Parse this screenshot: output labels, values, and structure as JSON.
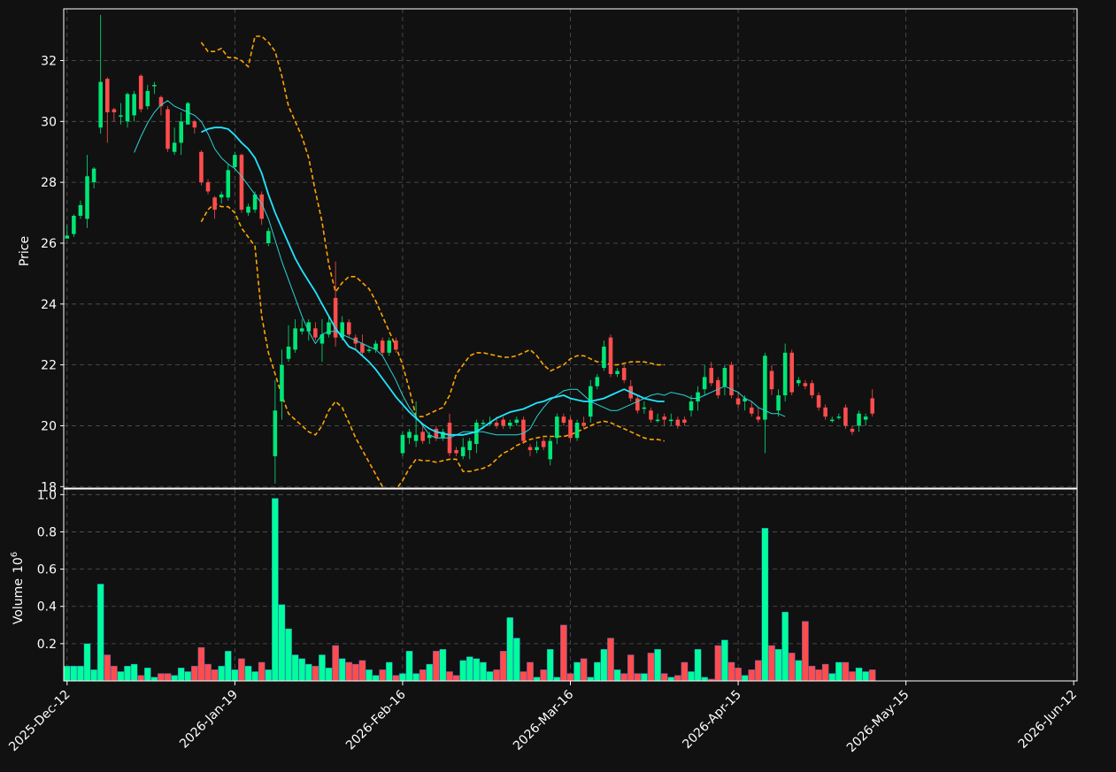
{
  "chart_data": {
    "type": "candlestick",
    "price_panel": {
      "ylabel": "Price",
      "ylim": [
        17.95,
        33.7
      ],
      "yticks": [
        18,
        20,
        22,
        24,
        26,
        28,
        30,
        32
      ],
      "ytick_labels": [
        "18",
        "20",
        "22",
        "24",
        "26",
        "28",
        "30",
        "32"
      ],
      "grid": true
    },
    "volume_panel": {
      "ylabel": "Volume",
      "ylabel_exponent": "10",
      "ylabel_exponent_power": "6",
      "ylim": [
        0,
        1.03
      ],
      "yticks": [
        0.2,
        0.4,
        0.6,
        0.8,
        1.0
      ],
      "ytick_labels": [
        "0.2",
        "0.4",
        "0.6",
        "0.8",
        "1.0"
      ],
      "grid": true
    },
    "x_ticks": [
      {
        "index": 0,
        "label": "2025-Dec-12"
      },
      {
        "index": 25,
        "label": "2026-Jan-19"
      },
      {
        "index": 50,
        "label": "2026-Feb-16"
      },
      {
        "index": 75,
        "label": "2026-Mar-16"
      },
      {
        "index": 100,
        "label": "2026-Apr-15"
      },
      {
        "index": 125,
        "label": "2026-May-15"
      },
      {
        "index": 150,
        "label": "2026-Jun-12"
      }
    ],
    "x_range": [
      -0.5,
      150.5
    ],
    "colors": {
      "up": "#00e676",
      "down": "#ff4d4d",
      "up_volume": "#00ff9c",
      "down_volume": "#ff4d4d",
      "sma_short": "#2ad4d4",
      "sma_long": "#22e5ff",
      "bands": "#ffa500",
      "background": "#111111",
      "grid": "#555555"
    },
    "candles": [
      [
        26.15,
        26.25,
        26.2,
        26.6
      ],
      [
        26.3,
        26.9,
        26.2,
        26.95
      ],
      [
        26.9,
        27.25,
        26.8,
        27.4
      ],
      [
        26.8,
        28.2,
        26.5,
        28.9
      ],
      [
        28.0,
        28.45,
        27.8,
        28.5
      ],
      [
        29.8,
        31.3,
        29.6,
        33.5
      ],
      [
        31.4,
        30.3,
        29.3,
        31.45
      ],
      [
        30.4,
        30.3,
        30.0,
        30.45
      ],
      [
        30.2,
        30.2,
        29.9,
        30.6
      ],
      [
        30.0,
        30.9,
        29.8,
        30.95
      ],
      [
        30.2,
        30.9,
        30.0,
        31.0
      ],
      [
        31.5,
        30.4,
        30.3,
        31.55
      ],
      [
        30.5,
        31.0,
        30.4,
        31.2
      ],
      [
        31.2,
        31.2,
        30.9,
        31.3
      ],
      [
        30.8,
        30.5,
        30.2,
        30.85
      ],
      [
        30.4,
        29.1,
        29.0,
        30.5
      ],
      [
        29.0,
        29.3,
        28.9,
        29.8
      ],
      [
        29.3,
        30.0,
        28.9,
        30.3
      ],
      [
        29.9,
        30.6,
        29.9,
        30.65
      ],
      [
        30.0,
        29.8,
        29.6,
        30.05
      ],
      [
        29.0,
        28.0,
        27.9,
        29.05
      ],
      [
        28.0,
        27.7,
        27.6,
        28.1
      ],
      [
        27.5,
        27.1,
        26.8,
        27.55
      ],
      [
        27.5,
        27.6,
        27.3,
        27.7
      ],
      [
        27.5,
        28.4,
        27.4,
        28.6
      ],
      [
        28.5,
        28.9,
        28.4,
        29.0
      ],
      [
        28.9,
        27.1,
        27.0,
        28.95
      ],
      [
        27.0,
        27.2,
        26.9,
        27.3
      ],
      [
        27.1,
        27.6,
        27.0,
        27.7
      ],
      [
        27.6,
        26.8,
        26.6,
        27.7
      ],
      [
        26.0,
        26.4,
        25.9,
        26.5
      ],
      [
        19.0,
        20.5,
        18.1,
        21.5
      ],
      [
        20.8,
        22.0,
        20.2,
        22.5
      ],
      [
        22.2,
        22.6,
        22.1,
        23.3
      ],
      [
        22.5,
        23.2,
        22.4,
        23.5
      ],
      [
        23.1,
        23.2,
        23.0,
        23.5
      ],
      [
        23.1,
        23.4,
        22.8,
        23.5
      ],
      [
        23.2,
        22.9,
        22.8,
        23.4
      ],
      [
        22.7,
        23.0,
        22.1,
        23.5
      ],
      [
        23.0,
        23.4,
        22.9,
        23.6
      ],
      [
        24.2,
        22.9,
        22.6,
        25.4
      ],
      [
        22.9,
        23.4,
        22.8,
        23.6
      ],
      [
        23.4,
        23.0,
        22.9,
        23.5
      ],
      [
        22.9,
        22.7,
        22.5,
        23.0
      ],
      [
        22.7,
        22.4,
        22.3,
        23.0
      ],
      [
        22.5,
        22.5,
        22.4,
        22.6
      ],
      [
        22.5,
        22.7,
        22.4,
        22.8
      ],
      [
        22.8,
        22.4,
        22.3,
        22.9
      ],
      [
        22.4,
        22.8,
        22.3,
        22.9
      ],
      [
        22.8,
        22.5,
        22.4,
        22.9
      ],
      [
        19.1,
        19.7,
        19.0,
        19.8
      ],
      [
        19.6,
        19.8,
        19.4,
        19.9
      ],
      [
        19.5,
        19.7,
        19.3,
        20.8
      ],
      [
        19.8,
        19.5,
        19.4,
        20.0
      ],
      [
        19.6,
        19.7,
        19.4,
        19.8
      ],
      [
        19.9,
        19.6,
        19.5,
        20.0
      ],
      [
        19.6,
        19.8,
        19.5,
        19.9
      ],
      [
        20.1,
        19.1,
        19.0,
        20.4
      ],
      [
        19.2,
        19.1,
        19.0,
        19.3
      ],
      [
        19.0,
        19.3,
        18.9,
        19.6
      ],
      [
        19.2,
        19.5,
        18.9,
        19.6
      ],
      [
        19.4,
        20.1,
        19.1,
        20.2
      ],
      [
        20.1,
        20.1,
        19.9,
        20.2
      ],
      [
        20.1,
        20.1,
        20.0,
        20.3
      ],
      [
        20.1,
        20.0,
        19.9,
        20.3
      ],
      [
        20.2,
        20.0,
        19.9,
        20.3
      ],
      [
        20.0,
        20.1,
        19.9,
        20.2
      ],
      [
        20.1,
        20.2,
        20.0,
        20.3
      ],
      [
        20.2,
        19.5,
        19.4,
        20.3
      ],
      [
        19.3,
        19.2,
        19.0,
        19.4
      ],
      [
        19.2,
        19.3,
        19.1,
        19.5
      ],
      [
        19.5,
        19.3,
        19.2,
        19.6
      ],
      [
        18.9,
        19.5,
        18.7,
        19.6
      ],
      [
        19.6,
        20.3,
        19.4,
        20.4
      ],
      [
        20.3,
        20.1,
        20.0,
        20.4
      ],
      [
        20.2,
        19.6,
        19.5,
        20.3
      ],
      [
        19.6,
        20.1,
        19.5,
        20.2
      ],
      [
        20.1,
        20.0,
        19.9,
        20.3
      ],
      [
        20.3,
        21.3,
        20.1,
        21.5
      ],
      [
        21.3,
        21.6,
        21.2,
        21.7
      ],
      [
        21.9,
        22.6,
        21.8,
        22.8
      ],
      [
        22.9,
        21.7,
        21.6,
        23.0
      ],
      [
        21.7,
        21.8,
        21.6,
        21.9
      ],
      [
        21.9,
        21.5,
        21.4,
        22.0
      ],
      [
        21.3,
        20.9,
        20.8,
        21.5
      ],
      [
        20.9,
        20.5,
        20.4,
        21.0
      ],
      [
        20.6,
        20.6,
        20.4,
        20.8
      ],
      [
        20.5,
        20.2,
        20.1,
        20.6
      ],
      [
        20.2,
        20.2,
        20.1,
        20.4
      ],
      [
        20.3,
        20.2,
        20.0,
        20.4
      ],
      [
        20.2,
        20.2,
        20.0,
        20.4
      ],
      [
        20.2,
        20.0,
        19.9,
        20.3
      ],
      [
        20.2,
        20.1,
        20.0,
        20.3
      ],
      [
        20.5,
        20.8,
        20.3,
        21.0
      ],
      [
        20.8,
        21.1,
        20.5,
        21.3
      ],
      [
        21.2,
        21.6,
        21.0,
        22.0
      ],
      [
        21.9,
        21.4,
        21.3,
        22.1
      ],
      [
        21.5,
        21.0,
        20.9,
        21.6
      ],
      [
        21.3,
        21.9,
        21.0,
        22.0
      ],
      [
        22.0,
        21.0,
        20.9,
        22.1
      ],
      [
        20.9,
        20.7,
        20.6,
        21.1
      ],
      [
        20.8,
        20.9,
        20.5,
        21.0
      ],
      [
        20.6,
        20.4,
        20.3,
        20.8
      ],
      [
        20.3,
        20.2,
        20.1,
        20.6
      ],
      [
        20.2,
        22.3,
        19.1,
        22.4
      ],
      [
        21.8,
        21.2,
        21.0,
        22.0
      ],
      [
        20.5,
        21.0,
        20.3,
        21.2
      ],
      [
        21.0,
        22.4,
        20.8,
        22.7
      ],
      [
        22.4,
        21.1,
        21.0,
        22.5
      ],
      [
        21.4,
        21.5,
        21.3,
        21.6
      ],
      [
        21.4,
        21.3,
        21.2,
        21.5
      ],
      [
        21.4,
        21.0,
        20.9,
        21.5
      ],
      [
        21.0,
        20.6,
        20.5,
        21.1
      ],
      [
        20.6,
        20.3,
        20.2,
        20.7
      ],
      [
        20.2,
        20.2,
        20.1,
        20.3
      ],
      [
        20.3,
        20.3,
        20.2,
        20.4
      ],
      [
        20.6,
        20.0,
        19.9,
        20.7
      ],
      [
        19.9,
        19.8,
        19.7,
        20.0
      ],
      [
        20.0,
        20.4,
        19.8,
        20.5
      ],
      [
        20.2,
        20.3,
        20.0,
        20.4
      ],
      [
        20.9,
        20.4,
        20.3,
        21.2
      ]
    ],
    "volume": [
      0.08,
      0.08,
      0.08,
      0.2,
      0.06,
      0.52,
      0.14,
      0.08,
      0.05,
      0.08,
      0.09,
      0.03,
      0.07,
      0.02,
      0.04,
      0.04,
      0.03,
      0.07,
      0.05,
      0.08,
      0.18,
      0.09,
      0.06,
      0.08,
      0.16,
      0.06,
      0.12,
      0.08,
      0.05,
      0.1,
      0.06,
      0.98,
      0.41,
      0.28,
      0.14,
      0.12,
      0.09,
      0.08,
      0.14,
      0.07,
      0.19,
      0.12,
      0.1,
      0.09,
      0.11,
      0.06,
      0.03,
      0.06,
      0.1,
      0.03,
      0.04,
      0.16,
      0.04,
      0.06,
      0.09,
      0.16,
      0.17,
      0.05,
      0.03,
      0.11,
      0.13,
      0.12,
      0.1,
      0.05,
      0.06,
      0.16,
      0.34,
      0.23,
      0.05,
      0.1,
      0.02,
      0.06,
      0.17,
      0.02,
      0.3,
      0.04,
      0.1,
      0.12,
      0.02,
      0.1,
      0.17,
      0.23,
      0.06,
      0.04,
      0.14,
      0.04,
      0.04,
      0.15,
      0.17,
      0.04,
      0.02,
      0.03,
      0.1,
      0.05,
      0.17,
      0.02,
      0.01,
      0.19,
      0.22,
      0.1,
      0.07,
      0.03,
      0.06,
      0.11,
      0.82,
      0.19,
      0.17,
      0.37,
      0.15,
      0.11,
      0.32,
      0.08,
      0.06,
      0.09,
      0.04,
      0.1,
      0.1,
      0.05,
      0.07,
      0.05,
      0.06
    ],
    "sma_short": {
      "start": 10,
      "values": [
        28.98,
        29.5,
        29.95,
        30.3,
        30.55,
        30.68,
        30.5,
        30.4,
        30.3,
        30.2,
        30.0,
        29.6,
        29.1,
        28.8,
        28.6,
        28.45,
        28.2,
        27.9,
        27.6,
        27.3,
        26.8,
        26.1,
        25.4,
        24.8,
        24.2,
        23.6,
        23.1,
        22.7,
        23.0,
        23.1,
        23.1,
        23.0,
        22.9,
        22.8,
        22.7,
        22.6,
        22.5,
        22.3,
        21.9,
        21.5,
        21.0,
        20.6,
        20.3,
        20.0,
        19.7,
        19.6,
        19.6,
        19.6,
        19.7,
        19.8,
        19.8,
        19.8,
        19.8,
        19.75,
        19.7,
        19.7,
        19.7,
        19.7,
        19.75,
        19.9,
        20.3,
        20.6,
        20.85,
        21.0,
        21.15,
        21.2,
        21.2,
        21.0,
        20.8,
        20.7,
        20.6,
        20.5,
        20.5,
        20.6,
        20.7,
        20.8,
        20.9,
        21.0,
        21.05,
        21.0,
        21.1,
        21.05,
        21.0,
        20.9,
        20.9,
        21.0,
        21.1,
        21.2,
        21.3,
        21.2,
        21.1,
        20.9,
        20.8,
        20.6,
        20.5,
        20.4,
        20.4,
        20.3
      ]
    },
    "sma_long": {
      "start": 20,
      "values": [
        29.65,
        29.75,
        29.8,
        29.8,
        29.75,
        29.55,
        29.3,
        29.1,
        28.8,
        28.3,
        27.6,
        27.0,
        26.5,
        26.0,
        25.5,
        25.1,
        24.75,
        24.4,
        24.0,
        23.6,
        23.2,
        22.9,
        22.6,
        22.5,
        22.3,
        22.1,
        21.85,
        21.55,
        21.25,
        20.95,
        20.7,
        20.45,
        20.25,
        20.05,
        19.9,
        19.8,
        19.75,
        19.7,
        19.7,
        19.7,
        19.75,
        19.8,
        19.95,
        20.1,
        20.25,
        20.35,
        20.45,
        20.5,
        20.55,
        20.65,
        20.75,
        20.8,
        20.9,
        20.95,
        21.0,
        20.9,
        20.85,
        20.8,
        20.8,
        20.85,
        20.9,
        21.0,
        21.1,
        21.2,
        21.1,
        21.0,
        20.9,
        20.85,
        20.8,
        20.8
      ]
    },
    "upper_band": {
      "start": 20,
      "values": [
        32.6,
        32.3,
        32.3,
        32.4,
        32.1,
        32.1,
        32.0,
        31.8,
        32.8,
        32.8,
        32.6,
        32.3,
        31.5,
        30.5,
        30.0,
        29.5,
        28.8,
        27.7,
        26.7,
        25.3,
        24.4,
        24.7,
        24.9,
        24.9,
        24.7,
        24.5,
        24.1,
        23.6,
        23.1,
        22.6,
        22.0,
        21.2,
        20.3,
        20.3,
        20.4,
        20.5,
        20.6,
        21.0,
        21.7,
        22.0,
        22.3,
        22.4,
        22.4,
        22.35,
        22.3,
        22.25,
        22.25,
        22.3,
        22.4,
        22.5,
        22.3,
        22.0,
        21.8,
        21.9,
        22.0,
        22.2,
        22.3,
        22.3,
        22.2,
        22.1,
        22.1,
        22.0,
        22.0,
        22.05,
        22.1,
        22.1,
        22.1,
        22.05,
        22.0,
        22.0
      ]
    },
    "lower_band": {
      "start": 20,
      "values": [
        26.7,
        27.1,
        27.3,
        27.2,
        27.2,
        27.0,
        26.5,
        26.2,
        25.9,
        23.6,
        22.4,
        21.7,
        21.0,
        20.4,
        20.2,
        20.0,
        19.8,
        19.7,
        20.0,
        20.5,
        20.8,
        20.6,
        20.1,
        19.6,
        19.2,
        18.8,
        18.4,
        18.0,
        17.7,
        17.9,
        18.2,
        18.6,
        18.9,
        18.85,
        18.85,
        18.8,
        18.85,
        18.9,
        18.9,
        18.5,
        18.5,
        18.55,
        18.6,
        18.7,
        18.9,
        19.1,
        19.2,
        19.35,
        19.45,
        19.55,
        19.6,
        19.65,
        19.65,
        19.65,
        19.65,
        19.7,
        19.8,
        19.9,
        20.0,
        20.1,
        20.15,
        20.1,
        20.0,
        19.9,
        19.8,
        19.7,
        19.6,
        19.55,
        19.55,
        19.5
      ]
    }
  }
}
